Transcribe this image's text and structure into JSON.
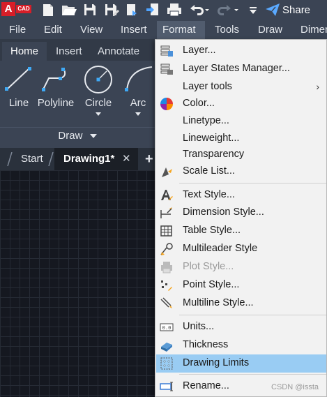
{
  "qat": {
    "logo_letter": "A",
    "logo_text": "CAD",
    "share_label": "Share",
    "icons": [
      "new-file-icon",
      "open-folder-icon",
      "save-icon",
      "save-as-icon",
      "open-from-web-icon",
      "save-to-web-icon",
      "print-icon",
      "undo-icon",
      "redo-icon",
      "customize-icon",
      "share-icon"
    ]
  },
  "menubar": {
    "items": [
      "File",
      "Edit",
      "View",
      "Insert",
      "Format",
      "Tools",
      "Draw",
      "Dimen"
    ],
    "active": "Format"
  },
  "ribbon": {
    "tabs": [
      "Home",
      "Insert",
      "Annotate"
    ],
    "active_tab": "Home",
    "tools": [
      "Line",
      "Polyline",
      "Circle",
      "Arc"
    ],
    "panel_title": "Draw"
  },
  "file_tabs": {
    "start": "Start",
    "drawing": "Drawing1*",
    "close_symbol": "✕",
    "add_symbol": "+"
  },
  "format_menu": {
    "items": [
      {
        "label": "Layer...",
        "icon": "layer-icon"
      },
      {
        "label": "Layer States Manager...",
        "icon": "layer-states-icon"
      },
      {
        "label": "Layer tools",
        "submenu_arrow": "›"
      },
      {
        "label": "Color...",
        "icon": "color-wheel-icon"
      },
      {
        "label": "Linetype..."
      },
      {
        "label": "Lineweight..."
      },
      {
        "label": "Transparency"
      },
      {
        "label": "Scale List...",
        "icon": "scale-list-icon"
      },
      {
        "label": "Text Style...",
        "icon": "text-style-icon"
      },
      {
        "label": "Dimension Style...",
        "icon": "dimension-style-icon"
      },
      {
        "label": "Table Style...",
        "icon": "table-style-icon"
      },
      {
        "label": "Multileader Style",
        "icon": "multileader-style-icon"
      },
      {
        "label": "Plot Style...",
        "icon": "plot-style-icon",
        "disabled": true
      },
      {
        "label": "Point Style...",
        "icon": "point-style-icon"
      },
      {
        "label": "Multiline Style...",
        "icon": "multiline-style-icon"
      },
      {
        "label": "Units...",
        "icon": "units-icon"
      },
      {
        "label": "Thickness",
        "icon": "thickness-icon"
      },
      {
        "label": "Drawing Limits",
        "icon": "drawing-limits-icon",
        "highlighted": true
      },
      {
        "label": "Rename...",
        "icon": "rename-icon"
      }
    ]
  },
  "watermark": "CSDN @issta",
  "colors": {
    "toolbar_bg": "#3b4454",
    "menu_bg": "#f2f2f2",
    "highlight": "#99ccf3",
    "logo_red": "#d71e28",
    "share_blue": "#5aa9ff"
  }
}
